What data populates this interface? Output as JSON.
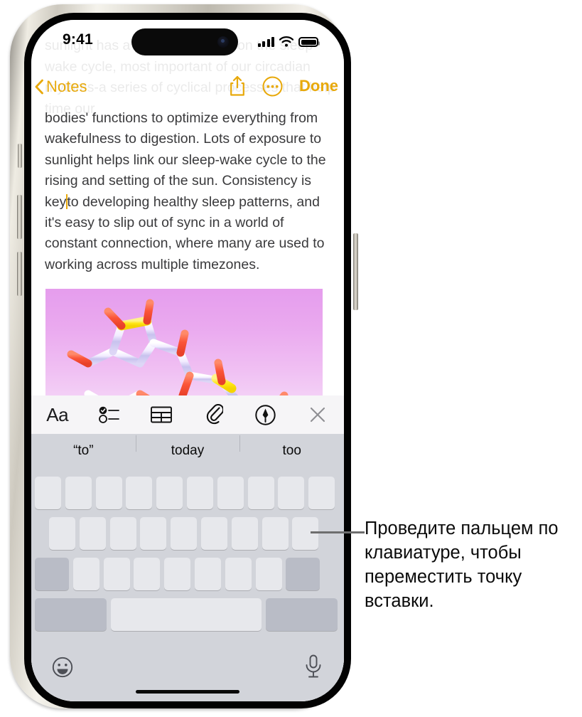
{
  "device": {
    "name": "iPhone",
    "status_bar": {
      "time": "9:41",
      "cellular_icon": "cellular-bars-icon",
      "wifi_icon": "wifi-icon",
      "battery_icon": "battery-full-icon"
    },
    "home_indicator": "home-indicator"
  },
  "app": {
    "name": "Notes",
    "navbar": {
      "back_label": "Notes",
      "back_icon": "chevron-left-icon",
      "share_icon": "share-icon",
      "more_icon": "more-circle-icon",
      "done_label": "Done",
      "accent_color": "#E8A90B"
    },
    "note": {
      "scrolled_off_text": "sunlight has a profound impact on the sleep-wake cycle, most important of our circadian rhythms-a series of cyclical processes that help time our",
      "body_before_caret": "bodies' functions to optimize everything from wakefulness to digestion. Lots of exposure to sunlight helps link our sleep-wake cycle to the rising and setting of the sun. Consistency is key",
      "body_after_caret": "to developing healthy sleep patterns, and it's easy to slip out of sync in a world of constant connection, where many are used to working across multiple timezones.",
      "text_color": "#3A3A3C",
      "attachment": {
        "name": "molecule-image",
        "description": "3D molecular structure render on pink gradient background"
      }
    },
    "format_toolbar": {
      "items": [
        {
          "label": "Aa",
          "icon": "text-format-icon"
        },
        {
          "label": "",
          "icon": "checklist-icon"
        },
        {
          "label": "",
          "icon": "table-icon"
        },
        {
          "label": "",
          "icon": "paperclip-icon"
        },
        {
          "label": "",
          "icon": "markup-pen-icon"
        },
        {
          "label": "",
          "icon": "close-icon"
        }
      ]
    }
  },
  "keyboard": {
    "predictions": [
      "“to”",
      "today",
      "too"
    ],
    "emoji_icon": "emoji-smiley-icon",
    "dictation_icon": "microphone-icon",
    "row_key_counts": [
      10,
      9,
      9,
      3
    ],
    "blank_keys": true,
    "background_color": "#D2D4DA",
    "key_color": "#E7E8EC",
    "modifier_key_color": "#B9BCC6"
  },
  "callout": {
    "text": "Проведите пальцем по клавиатуре, чтобы переместить точку вставки.",
    "leader_line": "callout-leader-line"
  }
}
